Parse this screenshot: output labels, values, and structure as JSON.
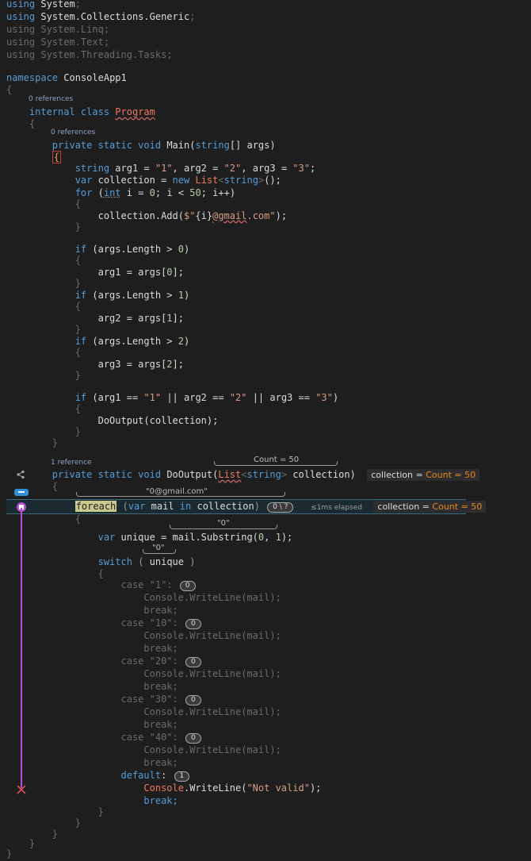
{
  "usings": [
    "using System;",
    "using System.Collections.Generic;",
    "using System.Linq;",
    "using System.Text;",
    "using System.Threading.Tasks;"
  ],
  "code": {
    "namespace_kw": "namespace",
    "namespace_name": "ConsoleApp1",
    "class_refs": "0 references",
    "main_refs": "0 references",
    "dooutput_refs": "1 reference",
    "class_mods": "internal class",
    "class_name": "Program",
    "main_sig_mods": "private static void",
    "main_name": "Main",
    "main_params": "(string[] args)",
    "dooutput_name": "DoOutput",
    "case_values": [
      "\"1\"",
      "\"10\"",
      "\"20\"",
      "\"30\"",
      "\"40\""
    ],
    "case_counts": [
      "0",
      "0",
      "0",
      "0",
      "0"
    ],
    "default_count": "1",
    "writeline": "Console.WriteLine(mail);",
    "not_valid_line": "Console.WriteLine(\"Not valid\");",
    "break_kw": "break;"
  },
  "debug": {
    "param_count_label": "Count = 50",
    "datatip1_label": "collection = ",
    "datatip1_value": "Count = 50",
    "foreach_mail_value": "\"0@gmail.com\"",
    "foreach_pill": "0 \\ ?",
    "elapsed": "≤1ms elapsed",
    "datatip2_label": "collection = ",
    "datatip2_value": "Count = 50",
    "substring_value": "\"0\"",
    "unique_value": "\"0\""
  },
  "colors": {
    "accent_purple": "#b94fd6",
    "datatip_orange": "#e8881c",
    "keyword_blue": "#569cd6"
  }
}
